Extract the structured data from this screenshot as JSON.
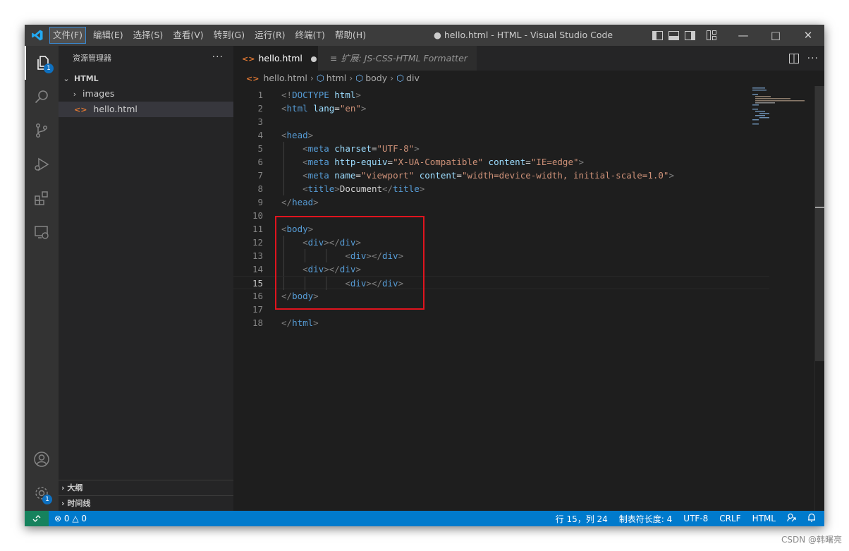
{
  "titlebar": {
    "menu": [
      "文件(F)",
      "编辑(E)",
      "选择(S)",
      "查看(V)",
      "转到(G)",
      "运行(R)",
      "终端(T)",
      "帮助(H)"
    ],
    "title": "● hello.html - HTML - Visual Studio Code",
    "window_controls": [
      "minimize-icon",
      "maximize-icon",
      "close-icon"
    ]
  },
  "activity": {
    "explorer_badge": "1",
    "settings_badge": "1",
    "icons": [
      "explorer-icon",
      "search-icon",
      "source-control-icon",
      "run-debug-icon",
      "extensions-icon",
      "remote-explorer-icon",
      "account-icon",
      "settings-gear-icon"
    ]
  },
  "sidebar": {
    "title": "资源管理器",
    "more": "···",
    "root": "HTML",
    "items": [
      {
        "label": "images",
        "type": "folder"
      },
      {
        "label": "hello.html",
        "type": "file",
        "icon": "<>"
      }
    ],
    "outline": "大纲",
    "timeline": "时间线"
  },
  "tabs": [
    {
      "label": "hello.html",
      "icon": "<>",
      "modified": true
    },
    {
      "label": "扩展: JS-CSS-HTML Formatter",
      "icon": "≡"
    }
  ],
  "breadcrumb": [
    "hello.html",
    "html",
    "body",
    "div"
  ],
  "editor": {
    "current_line": 15,
    "lines": [
      [
        [
          "p",
          "<!"
        ],
        [
          "tag",
          "DOCTYPE"
        ],
        [
          "text",
          " "
        ],
        [
          "attr",
          "html"
        ],
        [
          "p",
          ">"
        ]
      ],
      [
        [
          "p",
          "<"
        ],
        [
          "tag",
          "html"
        ],
        [
          "text",
          " "
        ],
        [
          "attr",
          "lang"
        ],
        [
          "text",
          "="
        ],
        [
          "str",
          "\"en\""
        ],
        [
          "p",
          ">"
        ]
      ],
      [],
      [
        [
          "p",
          "<"
        ],
        [
          "tag",
          "head"
        ],
        [
          "p",
          ">"
        ]
      ],
      [
        [
          "text",
          "    "
        ],
        [
          "p",
          "<"
        ],
        [
          "tag",
          "meta"
        ],
        [
          "text",
          " "
        ],
        [
          "attr",
          "charset"
        ],
        [
          "text",
          "="
        ],
        [
          "str",
          "\"UTF-8\""
        ],
        [
          "p",
          ">"
        ]
      ],
      [
        [
          "text",
          "    "
        ],
        [
          "p",
          "<"
        ],
        [
          "tag",
          "meta"
        ],
        [
          "text",
          " "
        ],
        [
          "attr",
          "http-equiv"
        ],
        [
          "text",
          "="
        ],
        [
          "str",
          "\"X-UA-Compatible\""
        ],
        [
          "text",
          " "
        ],
        [
          "attr",
          "content"
        ],
        [
          "text",
          "="
        ],
        [
          "str",
          "\"IE=edge\""
        ],
        [
          "p",
          ">"
        ]
      ],
      [
        [
          "text",
          "    "
        ],
        [
          "p",
          "<"
        ],
        [
          "tag",
          "meta"
        ],
        [
          "text",
          " "
        ],
        [
          "attr",
          "name"
        ],
        [
          "text",
          "="
        ],
        [
          "str",
          "\"viewport\""
        ],
        [
          "text",
          " "
        ],
        [
          "attr",
          "content"
        ],
        [
          "text",
          "="
        ],
        [
          "str",
          "\"width=device-width, initial-scale=1.0\""
        ],
        [
          "p",
          ">"
        ]
      ],
      [
        [
          "text",
          "    "
        ],
        [
          "p",
          "<"
        ],
        [
          "tag",
          "title"
        ],
        [
          "p",
          ">"
        ],
        [
          "text",
          "Document"
        ],
        [
          "p",
          "</"
        ],
        [
          "tag",
          "title"
        ],
        [
          "p",
          ">"
        ]
      ],
      [
        [
          "p",
          "</"
        ],
        [
          "tag",
          "head"
        ],
        [
          "p",
          ">"
        ]
      ],
      [],
      [
        [
          "p",
          "<"
        ],
        [
          "tag",
          "body"
        ],
        [
          "p",
          ">"
        ]
      ],
      [
        [
          "text",
          "    "
        ],
        [
          "p",
          "<"
        ],
        [
          "tag",
          "div"
        ],
        [
          "p",
          "></"
        ],
        [
          "tag",
          "div"
        ],
        [
          "p",
          ">"
        ]
      ],
      [
        [
          "text",
          "            "
        ],
        [
          "p",
          "<"
        ],
        [
          "tag",
          "div"
        ],
        [
          "p",
          "></"
        ],
        [
          "tag",
          "div"
        ],
        [
          "p",
          ">"
        ]
      ],
      [
        [
          "text",
          "    "
        ],
        [
          "p",
          "<"
        ],
        [
          "tag",
          "div"
        ],
        [
          "p",
          "></"
        ],
        [
          "tag",
          "div"
        ],
        [
          "p",
          ">"
        ]
      ],
      [
        [
          "text",
          "            "
        ],
        [
          "p",
          "<"
        ],
        [
          "tag",
          "div"
        ],
        [
          "p",
          "></"
        ],
        [
          "tag",
          "div"
        ],
        [
          "p",
          ">"
        ]
      ],
      [
        [
          "p",
          "</"
        ],
        [
          "tag",
          "body"
        ],
        [
          "p",
          ">"
        ]
      ],
      [],
      [
        [
          "p",
          "</"
        ],
        [
          "tag",
          "html"
        ],
        [
          "p",
          ">"
        ]
      ]
    ]
  },
  "statusbar": {
    "errors": "0",
    "warnings": "0",
    "position": "行 15，列 24",
    "tab_size": "制表符长度: 4",
    "encoding": "UTF-8",
    "eol": "CRLF",
    "language": "HTML"
  },
  "watermark": "CSDN @韩曙亮",
  "colors": {
    "statusbar": "#007acc",
    "highlight_box": "#e0141e",
    "tag": "#569cd6",
    "attr": "#9cdcfe",
    "string": "#ce9178"
  }
}
